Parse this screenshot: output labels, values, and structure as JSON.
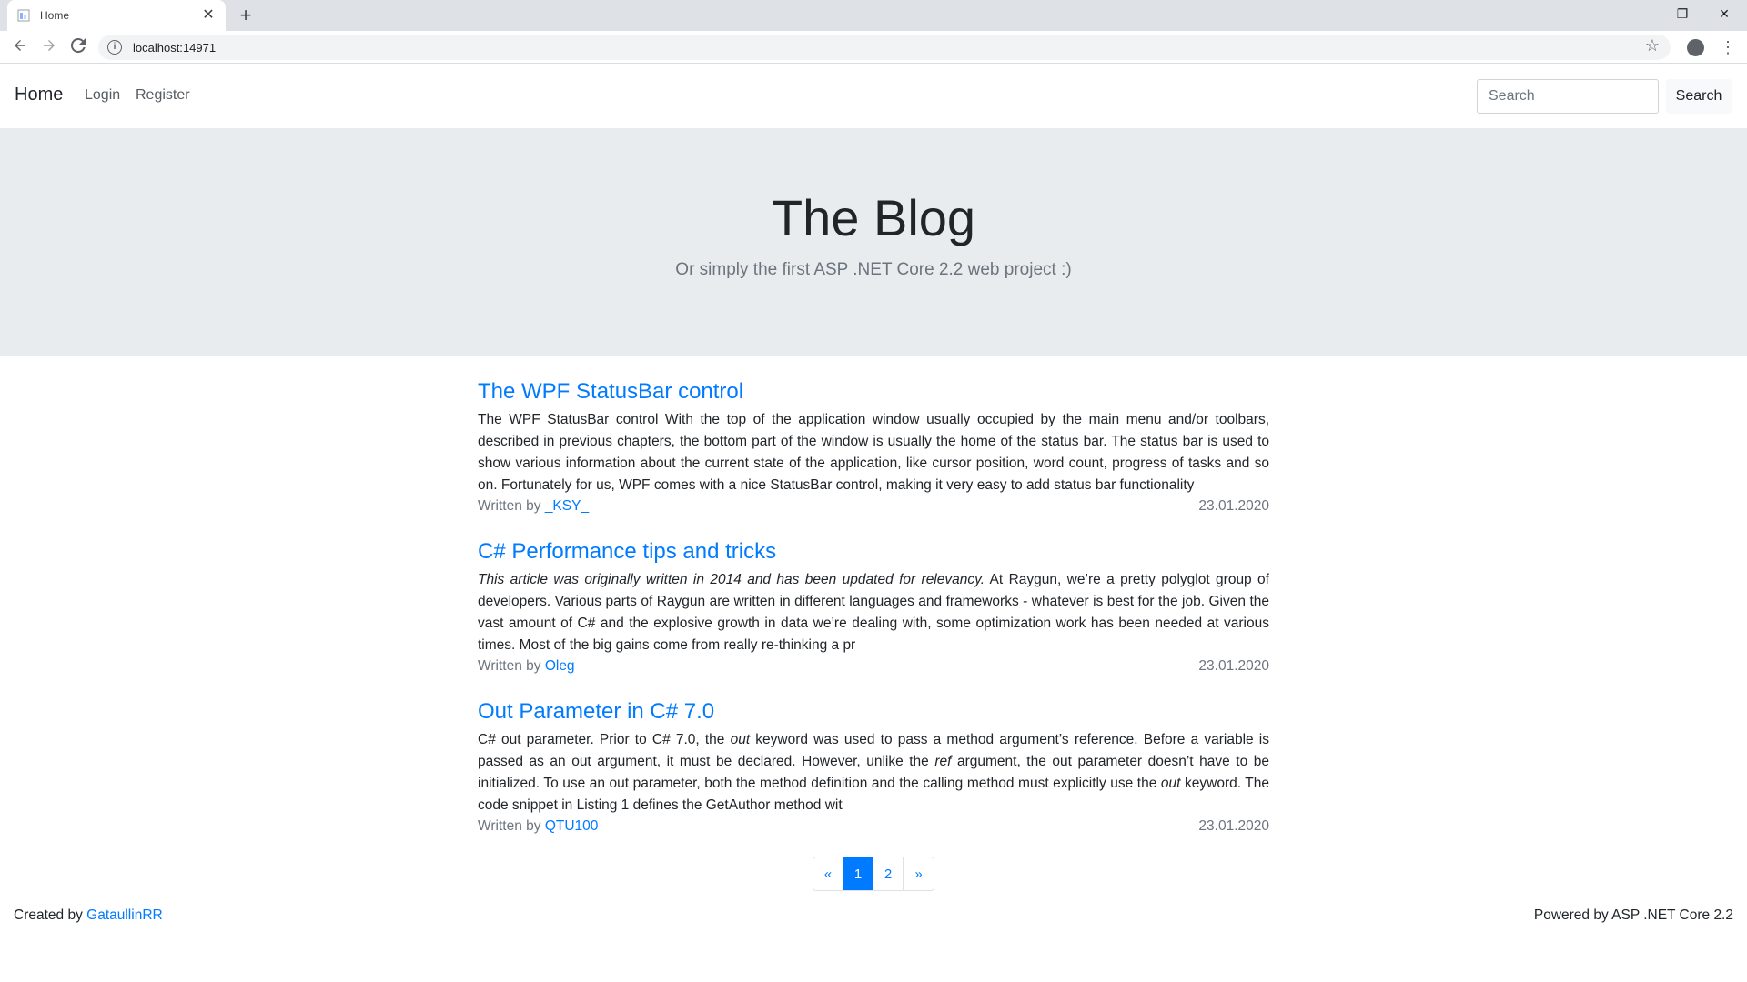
{
  "browser": {
    "tab_title": "Home",
    "tab_close": "✕",
    "new_tab": "+",
    "url": "localhost:14971",
    "window_controls": {
      "minimize": "—",
      "restore": "❐",
      "close": "✕"
    },
    "icons": [
      "back-icon",
      "forward-icon",
      "reload-icon",
      "info-icon",
      "star-icon",
      "profile-icon",
      "menu-icon"
    ]
  },
  "navbar": {
    "brand": "Home",
    "links": [
      "Login",
      "Register"
    ],
    "search_placeholder": "Search",
    "search_button": "Search"
  },
  "hero": {
    "title": "The Blog",
    "subtitle": "Or simply the first ASP .NET Core 2.2 web project :)"
  },
  "posts": [
    {
      "title": "The WPF StatusBar control",
      "excerpt": "The WPF StatusBar control With the top of the application window usually occupied by the main menu and/or toolbars, described in previous chapters, the bottom part of the window is usually the home of the status bar. The status bar is used to show various information about the current state of the application, like cursor position, word count, progress of tasks and so on. Fortunately for us, WPF comes with a nice StatusBar control, making it very easy to add status bar functionality",
      "written_by": "Written by",
      "author": "_KSY_",
      "date": "23.01.2020"
    },
    {
      "title": "C# Performance tips and tricks",
      "excerpt_italic": "This article was originally written in 2014 and has been updated for relevancy.",
      "excerpt": " At Raygun, we’re a pretty polyglot group of developers. Various parts of Raygun are written in different languages and frameworks - whatever is best for the job. Given the vast amount of C# and the explosive growth in data we’re dealing with, some optimization work has been needed at various times. Most of the big gains come from really re-thinking a pr",
      "written_by": "Written by",
      "author": "Oleg",
      "date": "23.01.2020"
    },
    {
      "title": "Out Parameter in C# 7.0",
      "excerpt_parts": [
        "C# out parameter. Prior to C# 7.0, the ",
        "out",
        " keyword was used to pass a method argument’s reference. Before a variable is passed as an out argument, it must be declared. However, unlike the ",
        "ref",
        " argument, the out parameter doesn’t have to be initialized. To use an out parameter, both the method definition and the calling method must explicitly use the ",
        "out",
        " keyword. The code snippet in Listing 1 defines the GetAuthor method wit"
      ],
      "written_by": "Written by",
      "author": "QTU100",
      "date": "23.01.2020"
    }
  ],
  "pagination": {
    "prev": "«",
    "pages": [
      "1",
      "2"
    ],
    "active_page": "1",
    "next": "»"
  },
  "footer": {
    "created_by": "Created by ",
    "author": "GataullinRR",
    "powered_by": "Powered by ASP .NET Core 2.2"
  },
  "colors": {
    "link": "#007bff",
    "hero_bg": "#e9ecef",
    "muted": "#6c757d"
  }
}
